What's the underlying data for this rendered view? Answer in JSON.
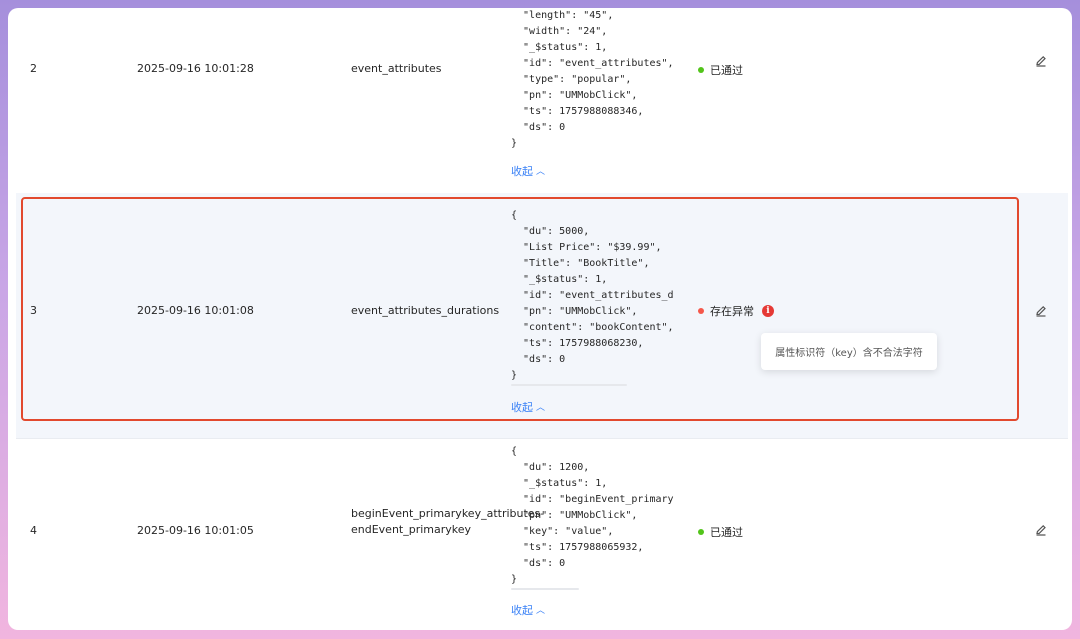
{
  "rows": [
    {
      "index": "2",
      "time": "2025-09-16 10:01:28",
      "event": "event_attributes",
      "json": "  \"length\": \"45\",\n  \"width\": \"24\",\n  \"_$status\": 1,\n  \"id\": \"event_attributes\",\n  \"type\": \"popular\",\n  \"pn\": \"UMMobClick\",\n  \"ts\": 1757988088346,\n  \"ds\": 0\n}",
      "collapse": "收起",
      "status": "已通过",
      "status_color": "#52c41a"
    },
    {
      "index": "3",
      "time": "2025-09-16 10:01:08",
      "event": "event_attributes_durations",
      "json": "{\n  \"du\": 5000,\n  \"List Price\": \"$39.99\",\n  \"Title\": \"BookTitle\",\n  \"_$status\": 1,\n  \"id\": \"event_attributes_d\n  \"pn\": \"UMMobClick\",\n  \"content\": \"bookContent\",\n  \"ts\": 1757988068230,\n  \"ds\": 0\n}",
      "collapse": "收起",
      "status": "存在异常",
      "status_color": "#f5574a",
      "tooltip": "属性标识符（key）含不合法字符"
    },
    {
      "index": "4",
      "time": "2025-09-16 10:01:05",
      "event": "beginEvent_primarykey_attributes-endEvent_primarykey",
      "json": "{\n  \"du\": 1200,\n  \"_$status\": 1,\n  \"id\": \"beginEvent_primary\n  \"pn\": \"UMMobClick\",\n  \"key\": \"value\",\n  \"ts\": 1757988065932,\n  \"ds\": 0\n}",
      "collapse": "收起",
      "status": "已通过",
      "status_color": "#52c41a"
    }
  ],
  "icons": {
    "edit": "edit-icon",
    "collapse": "chevron-up-icon",
    "info": "info-icon"
  },
  "colors": {
    "link": "#3b82f6",
    "highlight_border": "#e2492e",
    "selected_row_bg": "#f3f6fb"
  }
}
